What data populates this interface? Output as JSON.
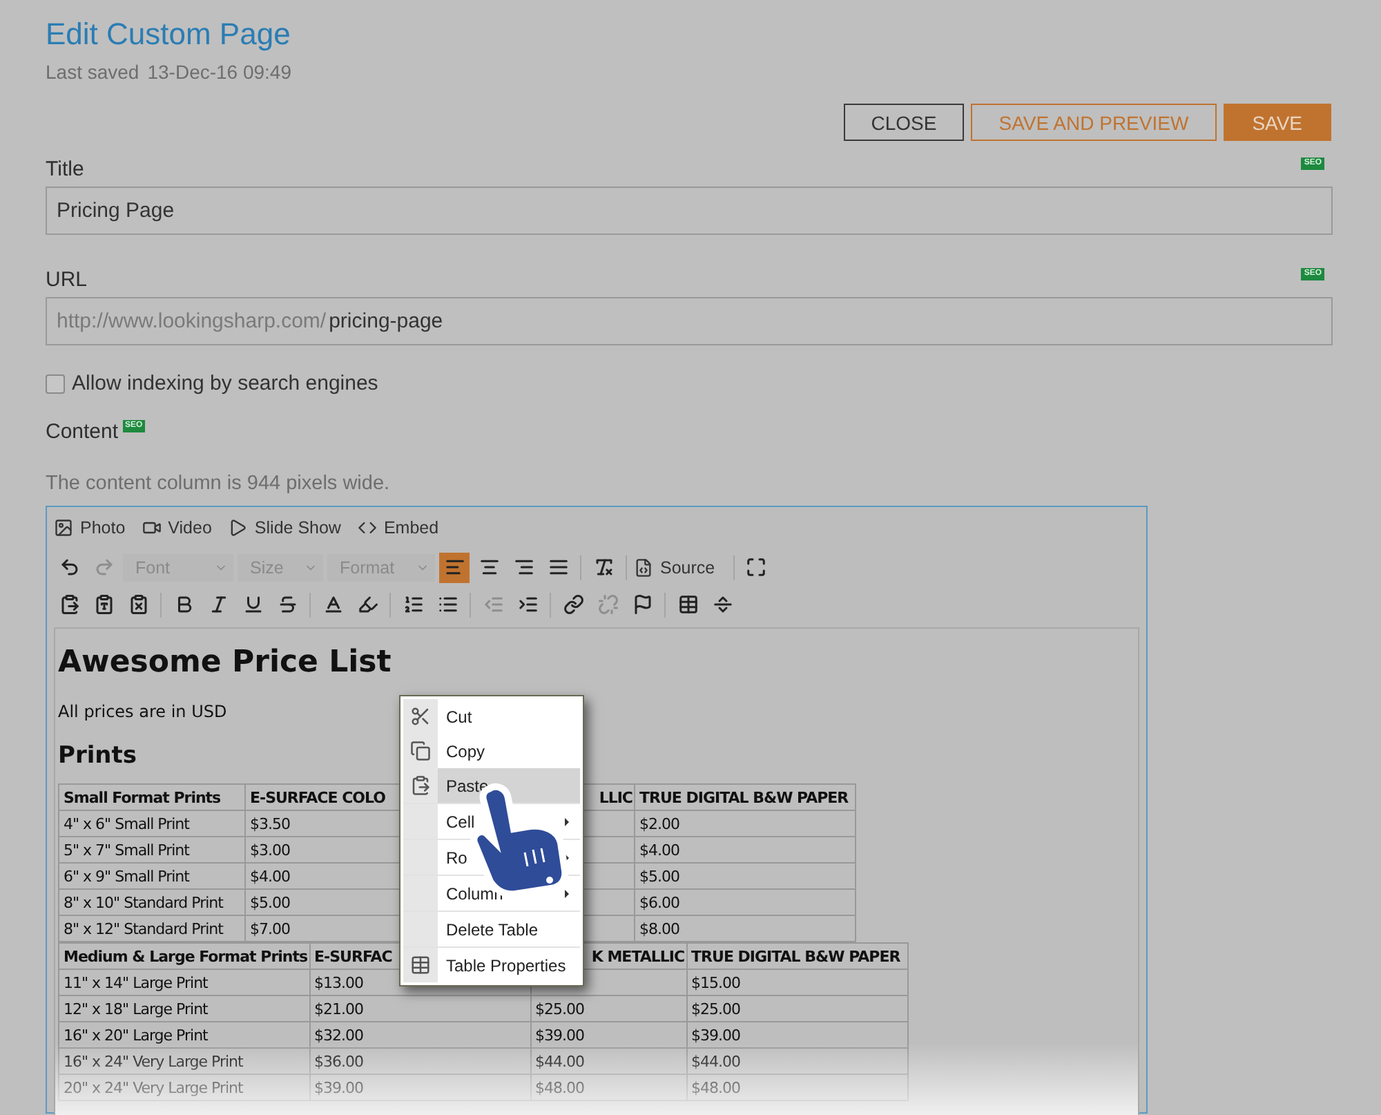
{
  "header": {
    "title": "Edit Custom Page",
    "last_saved_label": "Last saved",
    "last_saved": "13-Dec-16 09:49"
  },
  "buttons": [
    {
      "label": "CLOSE",
      "kind": "outline"
    },
    {
      "label": "SAVE AND PREVIEW",
      "kind": "accent-outline"
    },
    {
      "label": "SAVE",
      "kind": "primary"
    }
  ],
  "title_field": {
    "label": "Title",
    "badge": "SEO",
    "value": "Pricing Page"
  },
  "url_field": {
    "label": "URL",
    "badge": "SEO",
    "prefix": "http://www.lookingsharp.com/",
    "value": "pricing-page"
  },
  "indexing": {
    "label": "Allow indexing by search engines",
    "checked": false
  },
  "content": {
    "label": "Content",
    "badge": "SEO",
    "note": "The content column is 944 pixels wide."
  },
  "editor": {
    "insert_buttons": [
      {
        "label": "Photo",
        "kind": "photo"
      },
      {
        "label": "Video",
        "kind": "video"
      },
      {
        "label": "Slide Show",
        "kind": "slideshow"
      },
      {
        "label": "Embed",
        "kind": "embed"
      }
    ],
    "selects": [
      {
        "placeholder": "Font"
      },
      {
        "placeholder": "Size"
      },
      {
        "placeholder": "Format"
      }
    ],
    "alignment": [
      {
        "selected": true
      },
      {
        "selected": false
      },
      {
        "selected": false
      },
      {
        "selected": false
      }
    ],
    "source_label": "Source",
    "document": {
      "heading": "Awesome Price List",
      "intro": "All prices are in USD",
      "subheading": "Prints",
      "tables": [
        {
          "header": [
            "Small Format Prints",
            "E-SURFACE COLO",
            "LLIC",
            "TRUE DIGITAL B&W PAPER"
          ],
          "rows": [
            [
              "4\" x 6\" Small Print",
              "$3.50",
              "",
              "$2.00"
            ],
            [
              "5\" x 7\" Small Print",
              "$3.00",
              "",
              "$4.00"
            ],
            [
              "6\" x 9\" Small Print",
              "$4.00",
              "",
              "$5.00"
            ],
            [
              "8\" x 10\" Standard Print",
              "$5.00",
              "",
              "$6.00"
            ],
            [
              "8\" x 12\" Standard Print",
              "$7.00",
              "",
              "$8.00"
            ]
          ]
        },
        {
          "header": [
            "Medium & Large Format Prints",
            "E-SURFAC",
            "K METALLIC",
            "TRUE DIGITAL B&W PAPER"
          ],
          "rows": [
            [
              "11\" x 14\" Large Print",
              "$13.00",
              "",
              "$15.00"
            ],
            [
              "12\" x 18\" Large Print",
              "$21.00",
              "$25.00",
              "$25.00"
            ],
            [
              "16\" x 20\" Large Print",
              "$32.00",
              "$39.00",
              "$39.00"
            ],
            [
              "16\" x 24\" Very Large Print",
              "$36.00",
              "$44.00",
              "$44.00"
            ],
            [
              "20\" x 24\" Very Large Print",
              "$39.00",
              "$48.00",
              "$48.00"
            ]
          ]
        }
      ]
    }
  },
  "context_menu": [
    {
      "label": "Cut",
      "kind": "cut",
      "selected": false
    },
    {
      "label": "Copy",
      "kind": "copy",
      "selected": false
    },
    {
      "label": "Paste",
      "kind": "paste",
      "selected": true
    },
    {
      "label": "Cell",
      "kind": "submenu",
      "selected": false
    },
    {
      "label": "Ro",
      "kind": "submenu",
      "selected": false
    },
    {
      "label": "Column",
      "kind": "submenu",
      "selected": false
    },
    {
      "label": "Delete Table",
      "kind": "plain",
      "selected": false
    },
    {
      "label": "Table Properties",
      "kind": "table",
      "selected": false
    }
  ]
}
